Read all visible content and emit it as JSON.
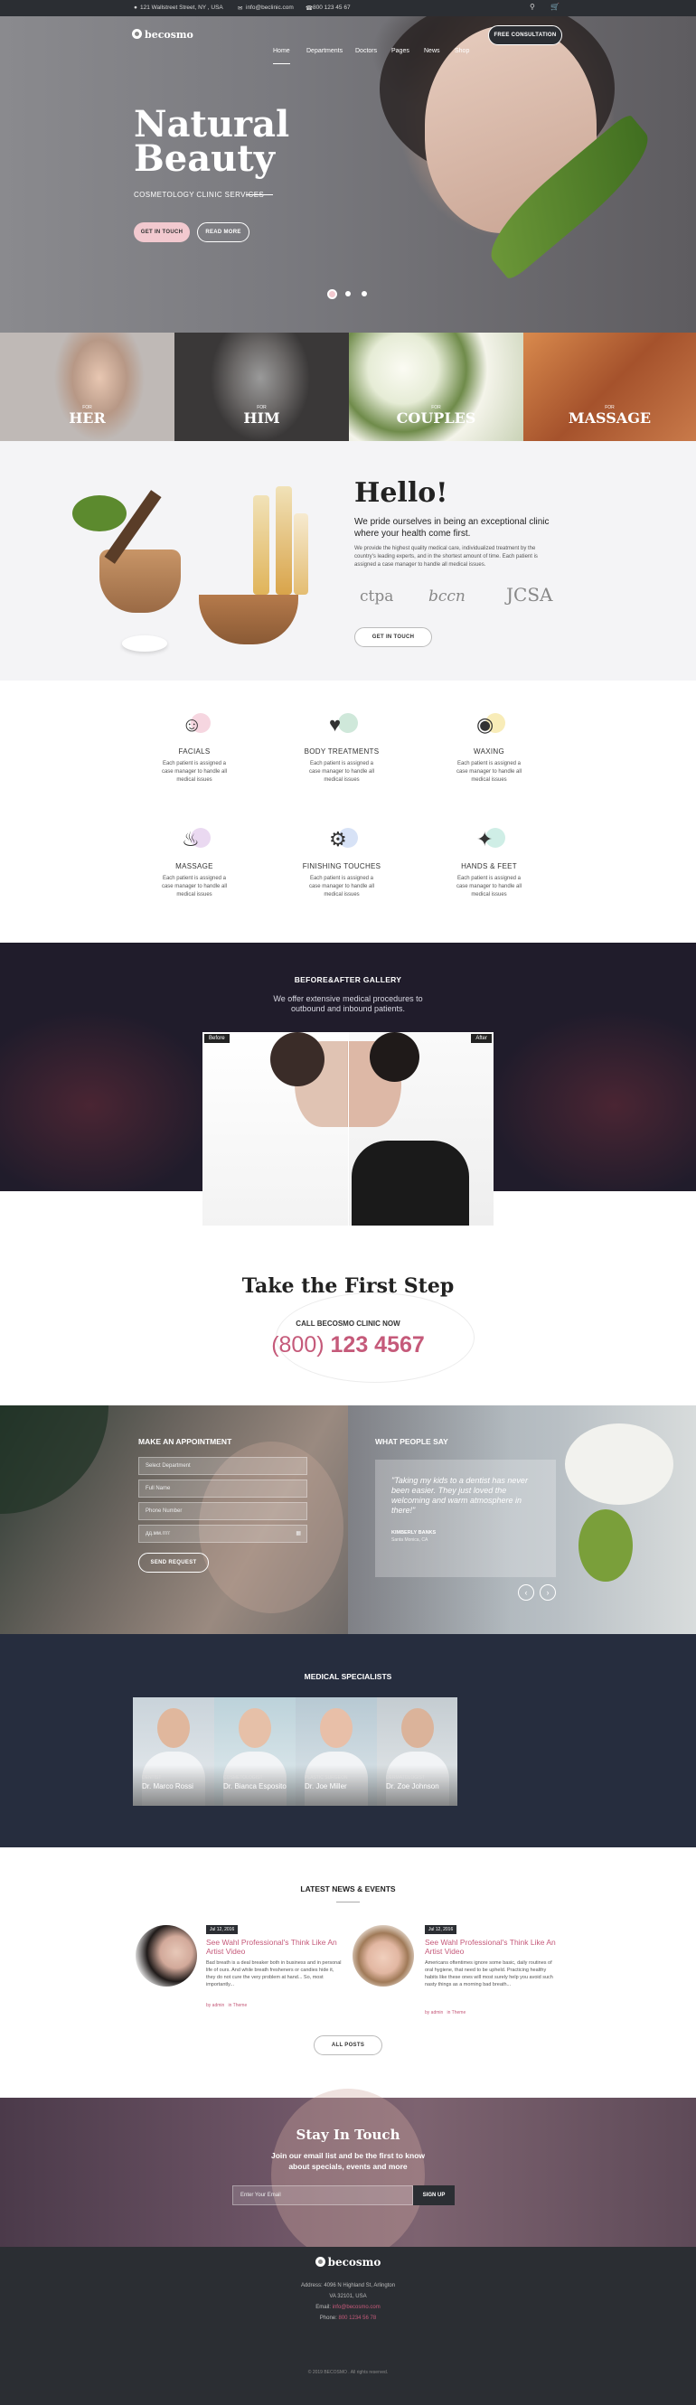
{
  "topbar": {
    "address": "121 Wallstreet Street, NY , USA",
    "email": "info@beclinic.com",
    "phone": "800 123 45 67"
  },
  "brand": {
    "name": "becosmo",
    "accent": "#e8b4be",
    "pink": "#c55a7a",
    "dark": "#2b2e33"
  },
  "nav": {
    "items": [
      "Home",
      "Departments",
      "Doctors",
      "Pages",
      "News",
      "Shop"
    ],
    "cta": "FREE CONSULTATION"
  },
  "hero": {
    "title_line1": "Natural",
    "title_line2": "Beauty",
    "subtitle": "COSMETOLOGY CLINIC SERVICES",
    "btn_primary": "GET IN TOUCH",
    "btn_secondary": "READ MORE"
  },
  "categories": [
    {
      "for": "FOR",
      "label": "HER"
    },
    {
      "for": "FOR",
      "label": "HIM"
    },
    {
      "for": "FOR",
      "label": "COUPLES"
    },
    {
      "for": "FOR",
      "label": "MASSAGE"
    }
  ],
  "hello": {
    "title": "Hello!",
    "lead": "We pride ourselves in being an exceptional clinic where your health come first.",
    "body": "We provide the highest quality medical care, individualized treatment by the country's leading experts, and in the shortest amount of time. Each patient is assigned a case manager to handle all medical issues.",
    "logos": [
      "ctpa",
      "bccn",
      "JCSA"
    ],
    "button": "GET IN TOUCH"
  },
  "services": [
    {
      "title": "FACIALS",
      "text": "Each patient is assigned a case manager to handle all medical issues",
      "icon": "face-icon"
    },
    {
      "title": "BODY TREATMENTS",
      "text": "Each patient is assigned a case manager to handle all medical issues",
      "icon": "robe-icon"
    },
    {
      "title": "WAXING",
      "text": "Each patient is assigned a case manager to handle all medical issues",
      "icon": "bowl-icon"
    },
    {
      "title": "MASSAGE",
      "text": "Each patient is assigned a case manager to handle all medical issues",
      "icon": "massage-icon"
    },
    {
      "title": "FINISHING TOUCHES",
      "text": "Each patient is assigned a case manager to handle all medical issues",
      "icon": "gears-icon"
    },
    {
      "title": "HANDS & FEET",
      "text": "Each patient is assigned a case manager to handle all medical issues",
      "icon": "feet-icon"
    }
  ],
  "gallery": {
    "title": "BEFORE&AFTER GALLERY",
    "text": "We offer extensive medical procedures to outbound and inbound patients.",
    "before": "Before",
    "after": "After"
  },
  "call": {
    "title": "Take the First Step",
    "label": "CALL BECOSMO CLINIC NOW",
    "phone_area": "(800)",
    "phone_num": "123 4567"
  },
  "appointment": {
    "title": "MAKE AN APPOINTMENT",
    "department_placeholder": "Select Department",
    "name_placeholder": "Full Name",
    "phone_placeholder": "Phone Number",
    "date_placeholder": "дд.мм.гггг",
    "button": "SEND REQUEST"
  },
  "testimonial": {
    "title": "WHAT PEOPLE SAY",
    "quote": "\"Taking my kids to a dentist has never been easier. They just loved the welcoming and warm atmosphere in there!\"",
    "author": "KIMBERLY BANKS",
    "location": "Santa Monica, CA"
  },
  "specialists": {
    "title": "MEDICAL SPECIALISTS",
    "doctors": [
      {
        "name": "Dr. Marco Rossi",
        "role": "DENTIST"
      },
      {
        "name": "Dr. Bianca Esposito",
        "role": "COSMETOLOGIST"
      },
      {
        "name": "Dr. Joe Miller",
        "role": "PLASTIC SURGEON"
      },
      {
        "name": "Dr. Zoe Johnson",
        "role": "DERMATOLOGIST"
      }
    ]
  },
  "news": {
    "title": "LATEST NEWS & EVENTS",
    "items": [
      {
        "date": "Jul 12, 2016",
        "title": "See Wahl Professional's Think Like An Artist Video",
        "text": "Bad breath is a deal breaker both in business and in personal life of ours. And while breath fresheners or candies hide it, they do not cure the very problem at hand... So, most importantly...",
        "author": "by admin",
        "category": "in Theme"
      },
      {
        "date": "Jul 12, 2016",
        "title": "See Wahl Professional's Think Like An Artist Video",
        "text": "Americans oftentimes ignore some basic, daily routines of oral hygiene, that need to be upheld. Practicing healthy habits like these ones will most surely help you avoid such nasty things as a morning bad breath...",
        "author": "by admin",
        "category": "in Theme"
      }
    ],
    "button": "ALL POSTS"
  },
  "touch": {
    "title": "Stay In Touch",
    "text": "Join our email list and be the first to know about specials, events and more",
    "placeholder": "Enter Your Email",
    "button": "SIGN UP"
  },
  "footer": {
    "brand": "becosmo",
    "address1": "Address: 4096 N Highland St, Arlington",
    "address2": "VA 32101, USA",
    "email_label": "Email:",
    "email": "info@becosmo.com",
    "phone_label": "Phone:",
    "phone": "800 1234 56 78",
    "copyright": "© 2019 BECOSMO . All rights reserved."
  }
}
